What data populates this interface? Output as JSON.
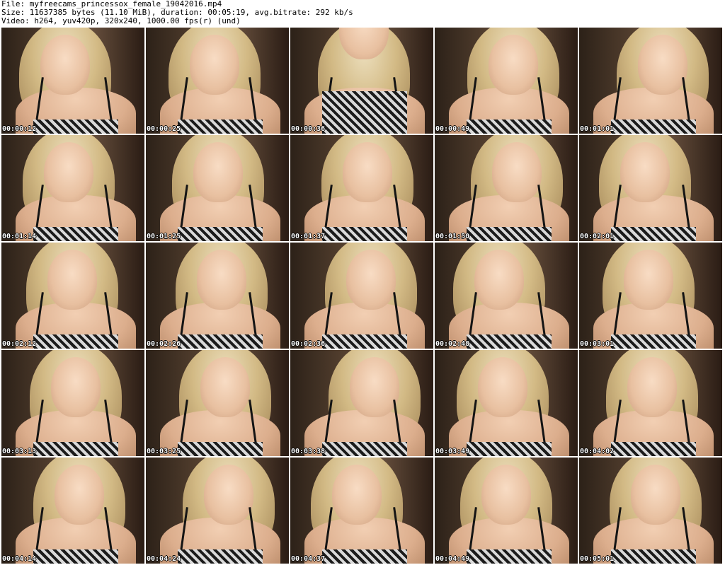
{
  "header": {
    "line1": "File: myfreecams_princessox_female_19042016.mp4",
    "line2": "Size: 11637385 bytes (11.10 MiB), duration: 00:05:19, avg.bitrate: 292 kb/s",
    "line3": "Video: h264, yuv420p, 320x240, 1000.00 fps(r) (und)"
  },
  "thumbnails": [
    {
      "timestamp": "00:00:12"
    },
    {
      "timestamp": "00:00:25"
    },
    {
      "timestamp": "00:00:36"
    },
    {
      "timestamp": "00:00:49"
    },
    {
      "timestamp": "00:01:01"
    },
    {
      "timestamp": "00:01:14"
    },
    {
      "timestamp": "00:01:25"
    },
    {
      "timestamp": "00:01:37"
    },
    {
      "timestamp": "00:01:50"
    },
    {
      "timestamp": "00:02:01"
    },
    {
      "timestamp": "00:02:12"
    },
    {
      "timestamp": "00:02:26"
    },
    {
      "timestamp": "00:02:36"
    },
    {
      "timestamp": "00:02:48"
    },
    {
      "timestamp": "00:03:01"
    },
    {
      "timestamp": "00:03:13"
    },
    {
      "timestamp": "00:03:25"
    },
    {
      "timestamp": "00:03:38"
    },
    {
      "timestamp": "00:03:49"
    },
    {
      "timestamp": "00:04:02"
    },
    {
      "timestamp": "00:04:14"
    },
    {
      "timestamp": "00:04:24"
    },
    {
      "timestamp": "00:04:37"
    },
    {
      "timestamp": "00:04:49"
    },
    {
      "timestamp": "00:05:01"
    }
  ]
}
